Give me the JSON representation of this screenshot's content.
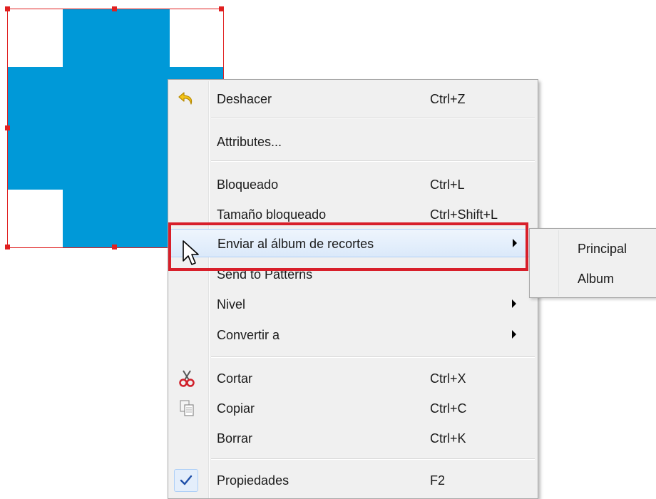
{
  "colors": {
    "shape_fill": "#0099d8",
    "selection": "#e02020",
    "annotation": "#d81f2a",
    "menu_bg": "#f0f0f0"
  },
  "menu": {
    "items": [
      {
        "label": "Deshacer",
        "shortcut": "Ctrl+Z",
        "icon": "undo-icon"
      },
      {
        "label": "Attributes...",
        "shortcut": ""
      },
      {
        "label": "Bloqueado",
        "shortcut": "Ctrl+L"
      },
      {
        "label": "Tamaño bloqueado",
        "shortcut": "Ctrl+Shift+L"
      },
      {
        "label": "Enviar al álbum de recortes",
        "shortcut": "",
        "submenu": true,
        "highlighted": true
      },
      {
        "label": "Send to Patterns",
        "shortcut": ""
      },
      {
        "label": "Nivel",
        "shortcut": "",
        "submenu": true
      },
      {
        "label": "Convertir a",
        "shortcut": "",
        "submenu": true
      },
      {
        "label": "Cortar",
        "shortcut": "Ctrl+X",
        "icon": "scissors-icon"
      },
      {
        "label": "Copiar",
        "shortcut": "Ctrl+C",
        "icon": "copy-icon"
      },
      {
        "label": "Borrar",
        "shortcut": "Ctrl+K"
      },
      {
        "label": "Propiedades",
        "shortcut": "F2",
        "icon": "checkmark-icon"
      }
    ]
  },
  "submenu": {
    "items": [
      {
        "label": "Principal"
      },
      {
        "label": "Album"
      }
    ]
  }
}
